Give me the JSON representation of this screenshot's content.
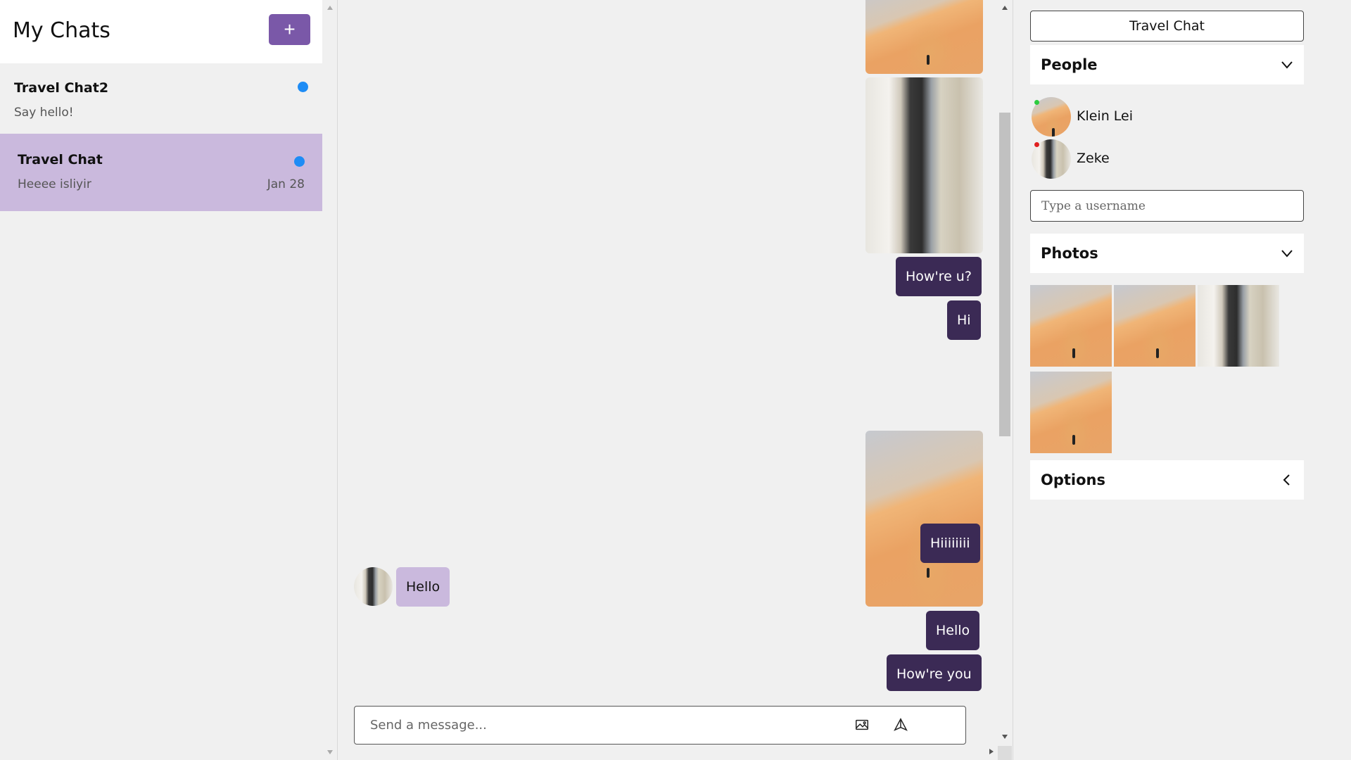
{
  "sidebar": {
    "title": "My Chats",
    "new_chat_label": "+",
    "chats": [
      {
        "name": "Travel Chat2",
        "preview": "Say hello!",
        "date": "",
        "unread": true
      },
      {
        "name": "Travel Chat",
        "preview": "Heeee isliyir",
        "date": "Jan 28",
        "unread": true,
        "selected": true
      }
    ]
  },
  "messages": [
    {
      "type": "image",
      "image": "dune",
      "direction": "out"
    },
    {
      "type": "image",
      "image": "couple",
      "direction": "out"
    },
    {
      "type": "text",
      "text": "How're u?",
      "direction": "out"
    },
    {
      "type": "text",
      "text": "Hi",
      "direction": "out"
    },
    {
      "type": "image",
      "image": "dune",
      "direction": "out"
    },
    {
      "type": "text",
      "text": "Hiiiiiiii",
      "direction": "out"
    },
    {
      "type": "text",
      "text": "Hello",
      "direction": "in"
    },
    {
      "type": "text",
      "text": "Hello",
      "direction": "out"
    },
    {
      "type": "text",
      "text": "How're you",
      "direction": "out"
    }
  ],
  "composer": {
    "placeholder": "Send a message...",
    "attach_icon": "image-icon",
    "send_icon": "send-icon"
  },
  "details": {
    "chat_title": "Travel Chat",
    "people_label": "People",
    "people": [
      {
        "name": "Klein Lei",
        "status_color": "#2ecc40"
      },
      {
        "name": "Zeke",
        "status_color": "#e02020"
      }
    ],
    "username_placeholder": "Type a username",
    "photos_label": "Photos",
    "photos": [
      "dune",
      "dune",
      "couple",
      "dune"
    ],
    "options_label": "Options"
  },
  "colors": {
    "accent": "#7a58a8",
    "selected_chat": "#cab9dd",
    "outgoing_bubble": "#3b2a55",
    "incoming_bubble": "#cab9dd",
    "unread_dot": "#1e8cf5"
  }
}
